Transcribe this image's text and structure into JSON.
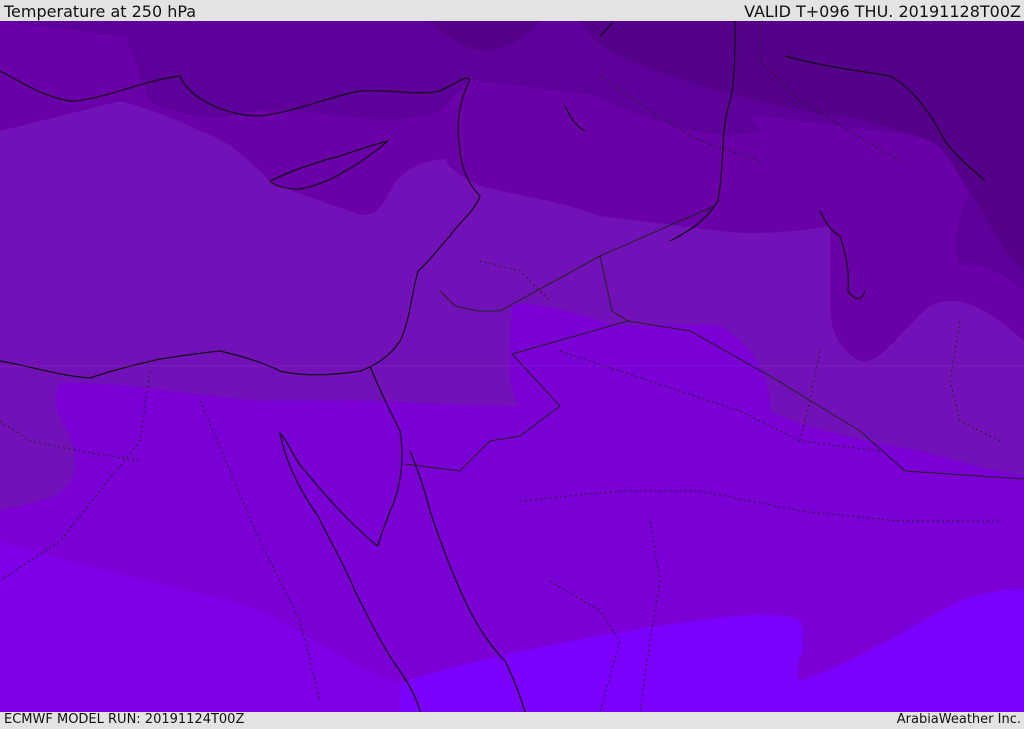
{
  "header": {
    "title": "Temperature at 250 hPa",
    "valid": "VALID T+096 THU. 20191128T00Z"
  },
  "footer": {
    "model_run": "ECMWF MODEL RUN: 20191124T00Z",
    "provider": "ArabiaWeather Inc."
  },
  "map": {
    "colors": {
      "band_coldest": "#54008a",
      "band_colder": "#5e009a",
      "band_cold": "#6a00a8",
      "band_mid": "#7311b8",
      "band_warm": "#7a00d6",
      "band_warmer": "#7d00e6",
      "band_warmest": "#7b00ff",
      "coastline": "#111111",
      "borders": "#222222"
    }
  }
}
